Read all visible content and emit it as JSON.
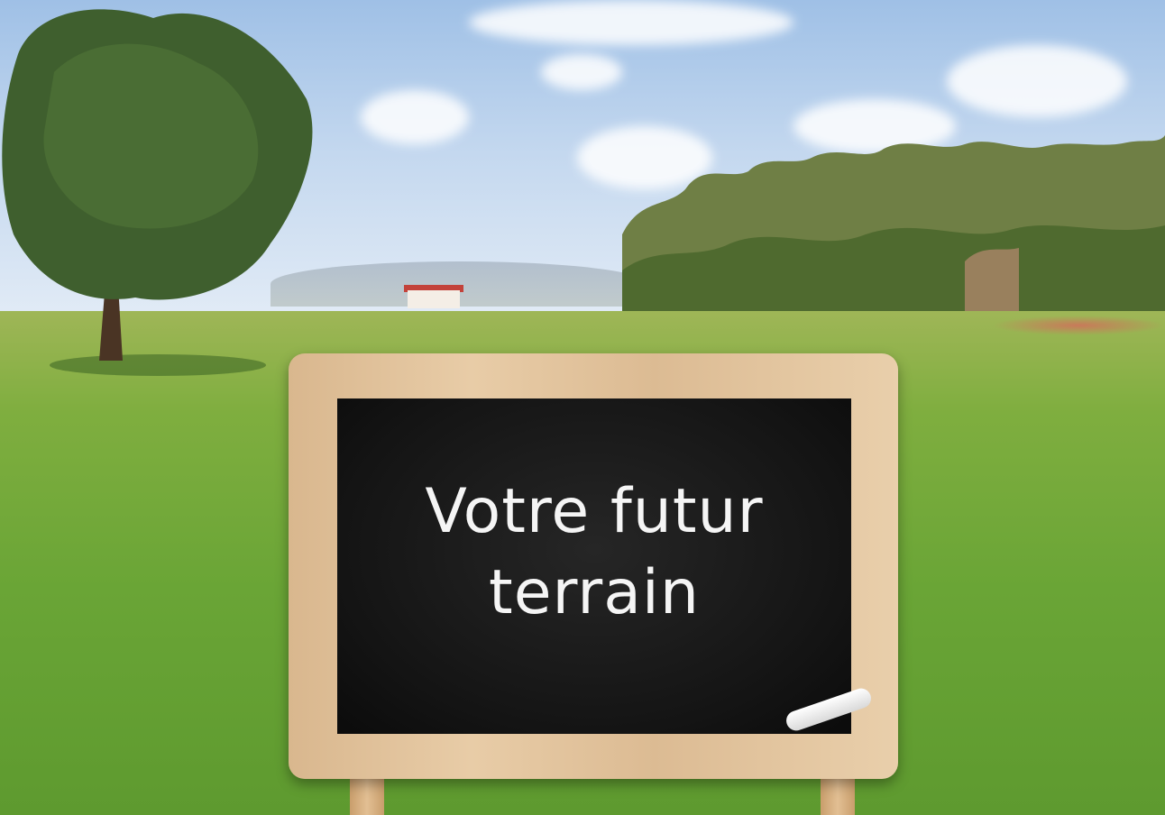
{
  "scene": {
    "description_icon": "landscape-photo",
    "colors": {
      "sky": "#b8d0ec",
      "grass": "#6aa536",
      "chalkboard": "#141414",
      "frame_wood": "#e2c29b",
      "chalk_text": "#f5f5f5"
    }
  },
  "sign": {
    "line1": "Votre futur",
    "line2": "terrain"
  }
}
